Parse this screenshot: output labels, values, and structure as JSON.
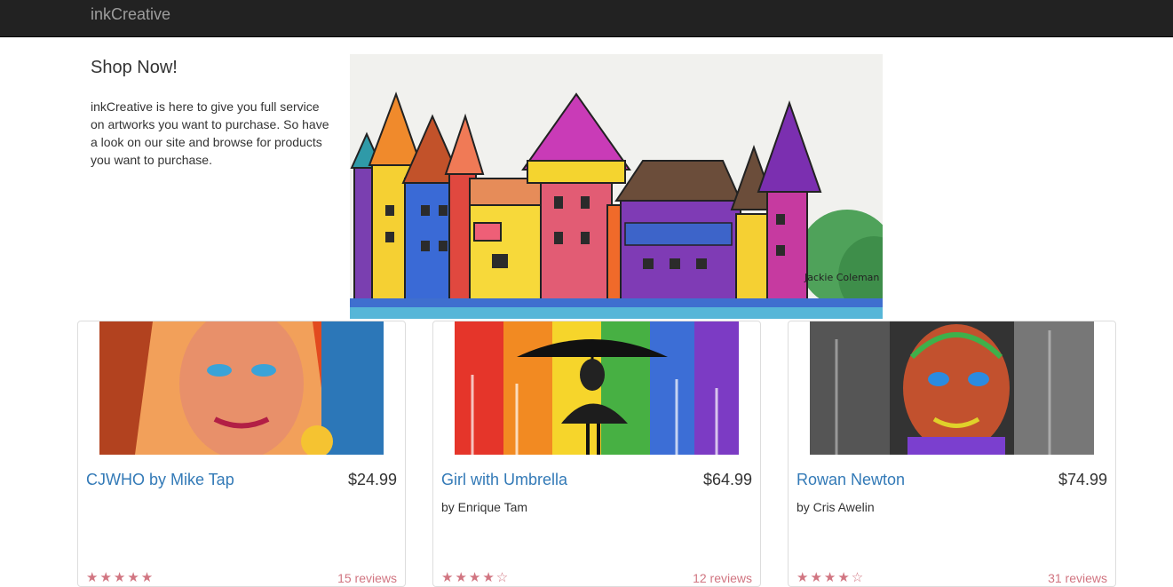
{
  "navbar": {
    "brand": "inkCreative"
  },
  "intro": {
    "title": "Shop Now!",
    "text": "inkCreative is here to give you full service on artworks you want to purchase. So have a look on our site and browse for products you want to purchase."
  },
  "hero": {
    "signature": "Jackie Coleman"
  },
  "products": [
    {
      "title": "CJWHO by Mike Tap",
      "price": "$24.99",
      "artist": "",
      "stars": "★★★★★",
      "reviews": "15 reviews"
    },
    {
      "title": "Girl with Umbrella",
      "price": "$64.99",
      "artist": "by Enrique Tam",
      "stars": "★★★★☆",
      "reviews": "12 reviews"
    },
    {
      "title": "Rowan Newton",
      "price": "$74.99",
      "artist": "by Cris Awelin",
      "stars": "★★★★☆",
      "reviews": "31 reviews"
    }
  ],
  "colors": {
    "navbar": "#222222",
    "link": "#337ab7",
    "rating": "#d17581"
  }
}
